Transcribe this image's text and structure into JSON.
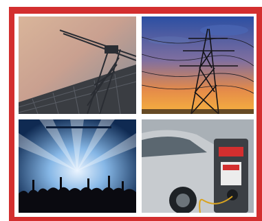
{
  "collage": {
    "photos": [
      {
        "subject": "construction-crane-photo"
      },
      {
        "subject": "power-pylon-sunset-photo"
      },
      {
        "subject": "concert-crowd-photo"
      },
      {
        "subject": "ev-charging-station-photo"
      }
    ],
    "colors": {
      "frame": "#d32f2f",
      "background": "#ffffff"
    }
  }
}
